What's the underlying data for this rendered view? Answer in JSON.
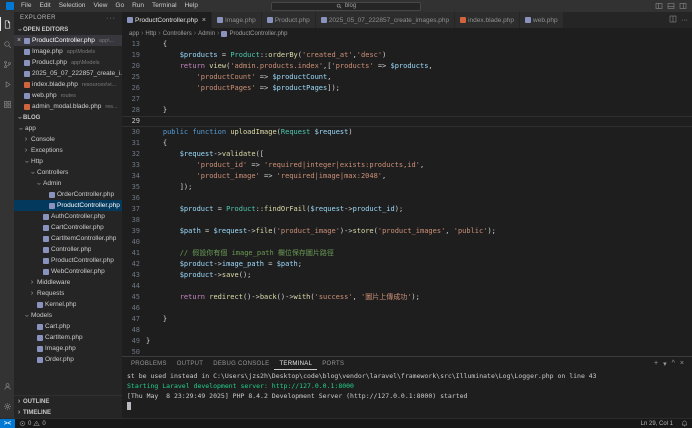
{
  "colors": {
    "accent": "#0078d4",
    "list_selection": "#04395e",
    "terminal_success": "#23d18b",
    "php_icon": "#8993be",
    "blade_icon": "#d1643c"
  },
  "menu_bar": {
    "items": [
      "File",
      "Edit",
      "Selection",
      "View",
      "Go",
      "Run",
      "Terminal",
      "Help"
    ],
    "command_center": "blog"
  },
  "activity_bar": {
    "top": [
      {
        "name": "explorer",
        "active": true
      },
      {
        "name": "search"
      },
      {
        "name": "source-control"
      },
      {
        "name": "run-debug"
      },
      {
        "name": "extensions"
      }
    ],
    "bottom": [
      {
        "name": "account"
      },
      {
        "name": "settings"
      }
    ]
  },
  "explorer": {
    "title": "EXPLORER",
    "open_editors_label": "OPEN EDITORS",
    "open_editors": [
      {
        "name": "ProductController.php",
        "desc": "app\\...",
        "icon": "php",
        "active": true
      },
      {
        "name": "Image.php",
        "desc": "app\\Models",
        "icon": "php"
      },
      {
        "name": "Product.php",
        "desc": "app\\Models",
        "icon": "php"
      },
      {
        "name": "2025_05_07_222857_create_i...",
        "desc": "",
        "icon": "php"
      },
      {
        "name": "index.blade.php",
        "desc": "resources\\vi...",
        "icon": "blade"
      },
      {
        "name": "web.php",
        "desc": "routes",
        "icon": "php"
      },
      {
        "name": "admin_modal.blade.php",
        "desc": "res...",
        "icon": "blade"
      }
    ],
    "project_label": "BLOG",
    "tree": [
      {
        "label": "app",
        "depth": 0,
        "chevron": "open"
      },
      {
        "label": "Console",
        "depth": 1,
        "chevron": "closed"
      },
      {
        "label": "Exceptions",
        "depth": 1,
        "chevron": "closed"
      },
      {
        "label": "Http",
        "depth": 1,
        "chevron": "open"
      },
      {
        "label": "Controllers",
        "depth": 2,
        "chevron": "open"
      },
      {
        "label": "Admin",
        "depth": 3,
        "chevron": "open"
      },
      {
        "label": "OrderController.php",
        "depth": 4,
        "icon": "php"
      },
      {
        "label": "ProductController.php",
        "depth": 4,
        "icon": "php",
        "selected": true
      },
      {
        "label": "AuthController.php",
        "depth": 3,
        "icon": "php"
      },
      {
        "label": "CartController.php",
        "depth": 3,
        "icon": "php"
      },
      {
        "label": "CartItemController.php",
        "depth": 3,
        "icon": "php"
      },
      {
        "label": "Controller.php",
        "depth": 3,
        "icon": "php"
      },
      {
        "label": "ProductController.php",
        "depth": 3,
        "icon": "php"
      },
      {
        "label": "WebController.php",
        "depth": 3,
        "icon": "php"
      },
      {
        "label": "Middleware",
        "depth": 2,
        "chevron": "closed"
      },
      {
        "label": "Requests",
        "depth": 2,
        "chevron": "closed"
      },
      {
        "label": "Kernel.php",
        "depth": 2,
        "icon": "php"
      },
      {
        "label": "Models",
        "depth": 1,
        "chevron": "open"
      },
      {
        "label": "Cart.php",
        "depth": 2,
        "icon": "php"
      },
      {
        "label": "CartItem.php",
        "depth": 2,
        "icon": "php"
      },
      {
        "label": "Image.php",
        "depth": 2,
        "icon": "php"
      },
      {
        "label": "Order.php",
        "depth": 2,
        "icon": "php"
      }
    ],
    "bottom_sections": [
      "OUTLINE",
      "TIMELINE"
    ]
  },
  "tabs": [
    {
      "label": "ProductController.php",
      "icon": "php",
      "active": true
    },
    {
      "label": "Image.php",
      "icon": "php"
    },
    {
      "label": "Product.php",
      "icon": "php"
    },
    {
      "label": "2025_05_07_222857_create_images.php",
      "icon": "php"
    },
    {
      "label": "index.blade.php",
      "icon": "blade"
    },
    {
      "label": "web.php",
      "icon": "php"
    }
  ],
  "breadcrumb": [
    "app",
    "Http",
    "Controllers",
    "Admin",
    "ProductController.php"
  ],
  "editor": {
    "lines": [
      {
        "n": "13",
        "t": [
          [
            "pln",
            "    {"
          ]
        ]
      },
      {
        "n": "19",
        "t": [
          [
            "pln",
            "        "
          ],
          [
            "var",
            "$products"
          ],
          [
            "pln",
            " = "
          ],
          [
            "cls",
            "Product"
          ],
          [
            "pln",
            "::"
          ],
          [
            "fn",
            "orderBy"
          ],
          [
            "pln",
            "("
          ],
          [
            "str",
            "'created_at'"
          ],
          [
            "pln",
            ","
          ],
          [
            "str",
            "'desc'"
          ],
          [
            "pln",
            ")"
          ]
        ]
      },
      {
        "n": "20",
        "t": [
          [
            "pln",
            "        "
          ],
          [
            "kw",
            "return"
          ],
          [
            "pln",
            " "
          ],
          [
            "fn",
            "view"
          ],
          [
            "pln",
            "("
          ],
          [
            "str",
            "'admin.products.index'"
          ],
          [
            "pln",
            ",["
          ],
          [
            "str",
            "'products'"
          ],
          [
            "pln",
            " => "
          ],
          [
            "var",
            "$products"
          ],
          [
            "pln",
            ","
          ]
        ]
      },
      {
        "n": "25",
        "t": [
          [
            "pln",
            "            "
          ],
          [
            "str",
            "'productCount'"
          ],
          [
            "pln",
            " => "
          ],
          [
            "var",
            "$productCount"
          ],
          [
            "pln",
            ","
          ]
        ]
      },
      {
        "n": "26",
        "t": [
          [
            "pln",
            "            "
          ],
          [
            "str",
            "'productPages'"
          ],
          [
            "pln",
            " => "
          ],
          [
            "var",
            "$productPages"
          ],
          [
            "pln",
            "]);"
          ]
        ]
      },
      {
        "n": "27",
        "t": []
      },
      {
        "n": "28",
        "t": [
          [
            "pln",
            "    }"
          ]
        ]
      },
      {
        "n": "29",
        "cur": true,
        "t": []
      },
      {
        "n": "30",
        "t": [
          [
            "pln",
            "    "
          ],
          [
            "kw2",
            "public"
          ],
          [
            "pln",
            " "
          ],
          [
            "kw2",
            "function"
          ],
          [
            "pln",
            " "
          ],
          [
            "fn",
            "uploadImage"
          ],
          [
            "pln",
            "("
          ],
          [
            "cls",
            "Request"
          ],
          [
            "pln",
            " "
          ],
          [
            "var",
            "$request"
          ],
          [
            "pln",
            ")"
          ]
        ]
      },
      {
        "n": "31",
        "t": [
          [
            "pln",
            "    {"
          ]
        ]
      },
      {
        "n": "32",
        "t": [
          [
            "pln",
            "        "
          ],
          [
            "var",
            "$request"
          ],
          [
            "pln",
            "->"
          ],
          [
            "fn",
            "validate"
          ],
          [
            "pln",
            "(["
          ]
        ]
      },
      {
        "n": "33",
        "t": [
          [
            "pln",
            "            "
          ],
          [
            "str",
            "'product_id'"
          ],
          [
            "pln",
            " => "
          ],
          [
            "str",
            "'required|integer|exists:products,id'"
          ],
          [
            "pln",
            ","
          ]
        ]
      },
      {
        "n": "34",
        "t": [
          [
            "pln",
            "            "
          ],
          [
            "str",
            "'product_image'"
          ],
          [
            "pln",
            " => "
          ],
          [
            "str",
            "'required|image|max:2048'"
          ],
          [
            "pln",
            ","
          ]
        ]
      },
      {
        "n": "35",
        "t": [
          [
            "pln",
            "        ]);"
          ]
        ]
      },
      {
        "n": "36",
        "t": []
      },
      {
        "n": "37",
        "t": [
          [
            "pln",
            "        "
          ],
          [
            "var",
            "$product"
          ],
          [
            "pln",
            " = "
          ],
          [
            "cls",
            "Product"
          ],
          [
            "pln",
            "::"
          ],
          [
            "fn",
            "findOrFail"
          ],
          [
            "pln",
            "("
          ],
          [
            "var",
            "$request"
          ],
          [
            "pln",
            "->"
          ],
          [
            "var",
            "product_id"
          ],
          [
            "pln",
            ");"
          ]
        ]
      },
      {
        "n": "38",
        "t": []
      },
      {
        "n": "39",
        "t": [
          [
            "pln",
            "        "
          ],
          [
            "var",
            "$path"
          ],
          [
            "pln",
            " = "
          ],
          [
            "var",
            "$request"
          ],
          [
            "pln",
            "->"
          ],
          [
            "fn",
            "file"
          ],
          [
            "pln",
            "("
          ],
          [
            "str",
            "'product_image'"
          ],
          [
            "pln",
            ")->"
          ],
          [
            "fn",
            "store"
          ],
          [
            "pln",
            "("
          ],
          [
            "str",
            "'product_images'"
          ],
          [
            "pln",
            ", "
          ],
          [
            "str",
            "'public'"
          ],
          [
            "pln",
            ");"
          ]
        ]
      },
      {
        "n": "40",
        "t": []
      },
      {
        "n": "41",
        "t": [
          [
            "pln",
            "        "
          ],
          [
            "com",
            "// 假設你有個 image_path 欄位保存圖片路徑"
          ]
        ]
      },
      {
        "n": "42",
        "t": [
          [
            "pln",
            "        "
          ],
          [
            "var",
            "$product"
          ],
          [
            "pln",
            "->"
          ],
          [
            "var",
            "image_path"
          ],
          [
            "pln",
            " = "
          ],
          [
            "var",
            "$path"
          ],
          [
            "pln",
            ";"
          ]
        ]
      },
      {
        "n": "43",
        "t": [
          [
            "pln",
            "        "
          ],
          [
            "var",
            "$product"
          ],
          [
            "pln",
            "->"
          ],
          [
            "fn",
            "save"
          ],
          [
            "pln",
            "();"
          ]
        ]
      },
      {
        "n": "44",
        "t": []
      },
      {
        "n": "45",
        "t": [
          [
            "pln",
            "        "
          ],
          [
            "kw",
            "return"
          ],
          [
            "pln",
            " "
          ],
          [
            "fn",
            "redirect"
          ],
          [
            "pln",
            "()->"
          ],
          [
            "fn",
            "back"
          ],
          [
            "pln",
            "()->"
          ],
          [
            "fn",
            "with"
          ],
          [
            "pln",
            "("
          ],
          [
            "str",
            "'success'"
          ],
          [
            "pln",
            ", "
          ],
          [
            "str",
            "'圖片上傳成功'"
          ],
          [
            "pln",
            ");"
          ]
        ]
      },
      {
        "n": "46",
        "t": []
      },
      {
        "n": "47",
        "t": [
          [
            "pln",
            "    }"
          ]
        ]
      },
      {
        "n": "48",
        "t": []
      },
      {
        "n": "49",
        "t": [
          [
            "pln",
            "}"
          ]
        ]
      },
      {
        "n": "50",
        "t": []
      }
    ]
  },
  "panel": {
    "tabs": [
      {
        "label": "PROBLEMS"
      },
      {
        "label": "OUTPUT"
      },
      {
        "label": "DEBUG CONSOLE"
      },
      {
        "label": "TERMINAL",
        "active": true
      },
      {
        "label": "PORTS"
      }
    ],
    "terminal_lines": [
      {
        "text": "st be used instead in C:\\Users\\jzs2h\\Desktop\\code\\blog\\vendor\\laravel\\framework\\src\\Illuminate\\Log\\Logger.php on line 43",
        "style": "plain"
      },
      {
        "text": "Starting Laravel development server: http://127.0.0.1:8000",
        "style": "green"
      },
      {
        "text": "[Thu May  8 23:29:49 2025] PHP 8.4.2 Development Server (http://127.0.0.1:8000) started",
        "style": "plain"
      }
    ]
  },
  "status_bar": {
    "remote": "><",
    "errors": "0",
    "warnings": "0",
    "cursor": "Ln 29, Col 1"
  }
}
